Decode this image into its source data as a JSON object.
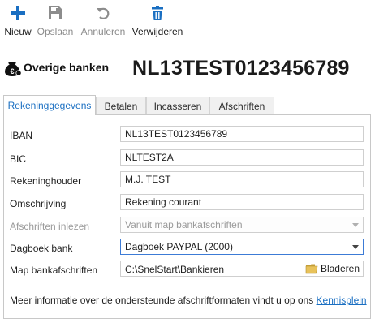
{
  "toolbar": {
    "new_label": "Nieuw",
    "save_label": "Opslaan",
    "cancel_label": "Annuleren",
    "delete_label": "Verwijderen"
  },
  "header": {
    "bank_name": "Overige banken",
    "account_iban": "NL13TEST0123456789"
  },
  "tabs": [
    {
      "label": "Rekeninggegevens",
      "active": true
    },
    {
      "label": "Betalen",
      "active": false
    },
    {
      "label": "Incasseren",
      "active": false
    },
    {
      "label": "Afschriften",
      "active": false
    }
  ],
  "form": {
    "iban": {
      "label": "IBAN",
      "value": "NL13TEST0123456789"
    },
    "bic": {
      "label": "BIC",
      "value": "NLTEST2A"
    },
    "holder": {
      "label": "Rekeninghouder",
      "value": "M.J. TEST"
    },
    "description": {
      "label": "Omschrijving",
      "value": "Rekening courant"
    },
    "import": {
      "label": "Afschriften inlezen",
      "value": "Vanuit map bankafschriften",
      "disabled": true
    },
    "journal": {
      "label": "Dagboek bank",
      "value": "Dagboek PAYPAL (2000)"
    },
    "folder": {
      "label": "Map bankafschriften",
      "value": "C:\\SnelStart\\Bankieren",
      "browse_label": "Bladeren"
    }
  },
  "info": {
    "text": "Meer informatie over de ondersteunde afschriftformaten vindt u op ons ",
    "link_label": "Kennisplein"
  },
  "colors": {
    "accent_blue": "#1a6fc2",
    "disabled_gray": "#8a8a8a",
    "folder_yellow": "#e8c25a"
  },
  "icons": {
    "new": "plus-icon",
    "save": "floppy-disk-icon",
    "cancel": "undo-arrow-icon",
    "delete": "trash-icon",
    "bank": "coin-bag-icon",
    "browse": "folder-icon"
  }
}
